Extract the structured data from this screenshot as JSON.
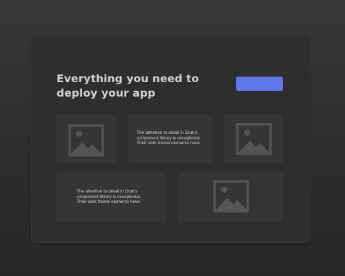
{
  "hero": {
    "title": "Everything you need to deploy your app",
    "cta_color": "#6277ea"
  },
  "cards": [
    {
      "type": "image",
      "icon": "image-placeholder-icon"
    },
    {
      "type": "testimonial",
      "text": "The attention to detail in Druk's component library is exceptional. Their dark theme elements have"
    },
    {
      "type": "image",
      "icon": "image-placeholder-icon"
    },
    {
      "type": "testimonial",
      "text": "The attention to detail in Druk's component library is exceptional. Their dark theme elements have"
    },
    {
      "type": "image",
      "icon": "image-placeholder-icon"
    }
  ]
}
